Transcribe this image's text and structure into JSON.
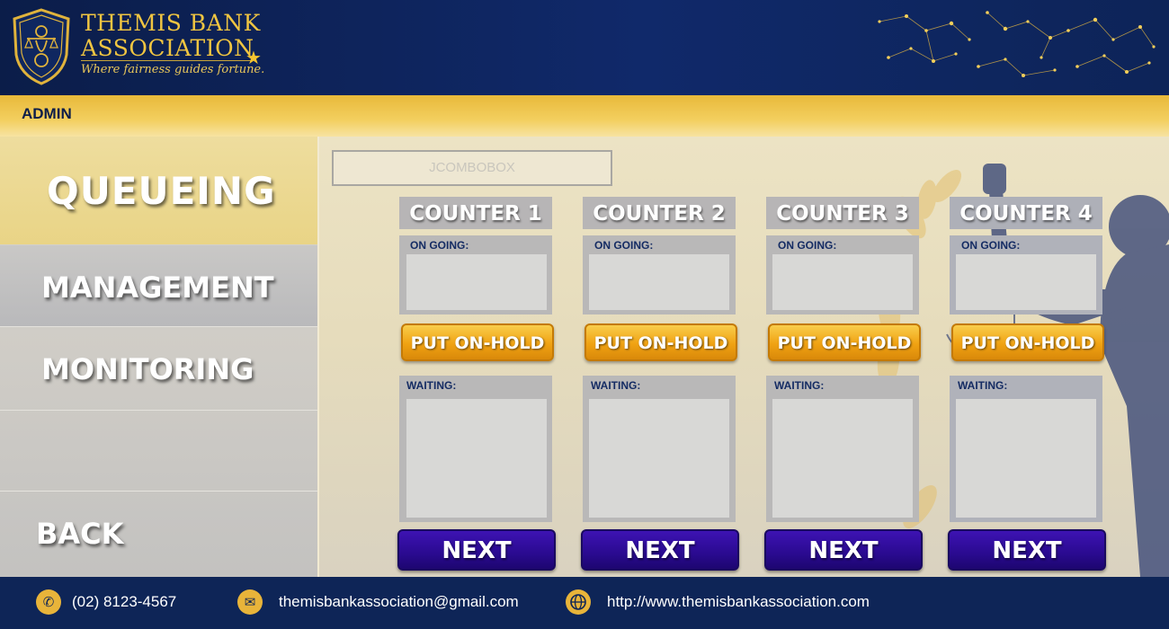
{
  "header": {
    "brand_line1": "THEMIS BANK",
    "brand_line2": "ASSOCIATION",
    "tagline": "Where fairness guides fortune.",
    "logo_icon": "lady-justice-shield-icon"
  },
  "adminbar": {
    "label": "ADMIN"
  },
  "sidebar": {
    "items": [
      {
        "label": "QUEUEING",
        "active": true
      },
      {
        "label": "MANAGEMENT"
      },
      {
        "label": "MONITORING"
      }
    ],
    "back_label": "BACK"
  },
  "main": {
    "combo_placeholder": "JCOMBOBOX",
    "counters": [
      {
        "title": "COUNTER 1",
        "ongoing_label": "ON GOING:",
        "hold_label": "PUT ON-HOLD",
        "waiting_label": "WAITING:",
        "next_label": "NEXT"
      },
      {
        "title": "COUNTER 2",
        "ongoing_label": "ON GOING:",
        "hold_label": "PUT ON-HOLD",
        "waiting_label": "WAITING:",
        "next_label": "NEXT"
      },
      {
        "title": "COUNTER 3",
        "ongoing_label": "ON GOING:",
        "hold_label": "PUT ON-HOLD",
        "waiting_label": "WAITING:",
        "next_label": "NEXT"
      },
      {
        "title": "COUNTER 4",
        "ongoing_label": "ON GOING:",
        "hold_label": "PUT ON-HOLD",
        "waiting_label": "WAITING:",
        "next_label": "NEXT"
      }
    ]
  },
  "footer": {
    "phone": "(02) 8123-4567",
    "email": "themisbankassociation@gmail.com",
    "website": "http://www.themisbankassociation.com",
    "phone_icon": "phone-icon",
    "email_icon": "mail-icon",
    "web_icon": "globe-icon"
  },
  "colors": {
    "navy": "#0e2557",
    "gold": "#f0c541",
    "hold_orange": "#f0a212",
    "next_purple": "#2a0a90"
  }
}
